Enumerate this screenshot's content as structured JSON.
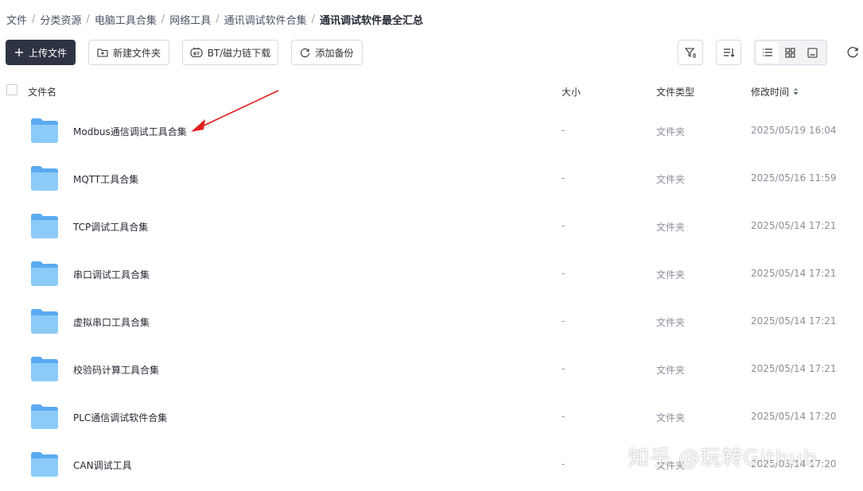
{
  "breadcrumb": [
    "文件",
    "分类资源",
    "电脑工具合集",
    "网络工具",
    "通讯调试软件合集",
    "通讯调试软件最全汇总"
  ],
  "breadcrumb_sep": "/",
  "toolbar": {
    "upload_label": "上传文件",
    "new_folder_label": "新建文件夹",
    "bt_label": "BT/磁力链下载",
    "backup_label": "添加备份"
  },
  "columns": {
    "name": "文件名",
    "size": "大小",
    "type": "文件类型",
    "modified": "修改时间"
  },
  "rows": [
    {
      "name": "Modbus通信调试工具合集",
      "size": "-",
      "type": "文件夹",
      "modified": "2025/05/19 16:04"
    },
    {
      "name": "MQTT工具合集",
      "size": "-",
      "type": "文件夹",
      "modified": "2025/05/16 11:59"
    },
    {
      "name": "TCP调试工具合集",
      "size": "-",
      "type": "文件夹",
      "modified": "2025/05/14 17:21"
    },
    {
      "name": "串口调试工具合集",
      "size": "-",
      "type": "文件夹",
      "modified": "2025/05/14 17:21"
    },
    {
      "name": "虚拟串口工具合集",
      "size": "-",
      "type": "文件夹",
      "modified": "2025/05/14 17:21"
    },
    {
      "name": "校验码计算工具合集",
      "size": "-",
      "type": "文件夹",
      "modified": "2025/05/14 17:21"
    },
    {
      "name": "PLC通信调试软件合集",
      "size": "-",
      "type": "文件夹",
      "modified": "2025/05/14 17:20"
    },
    {
      "name": "CAN调试工具",
      "size": "-",
      "type": "文件夹",
      "modified": "2025/05/14 17:20"
    }
  ],
  "watermark": "知乎 @玩转Github",
  "colors": {
    "primary_button": "#2e3442",
    "folder": "#6bb6f1",
    "annotation_arrow": "#e02020"
  }
}
